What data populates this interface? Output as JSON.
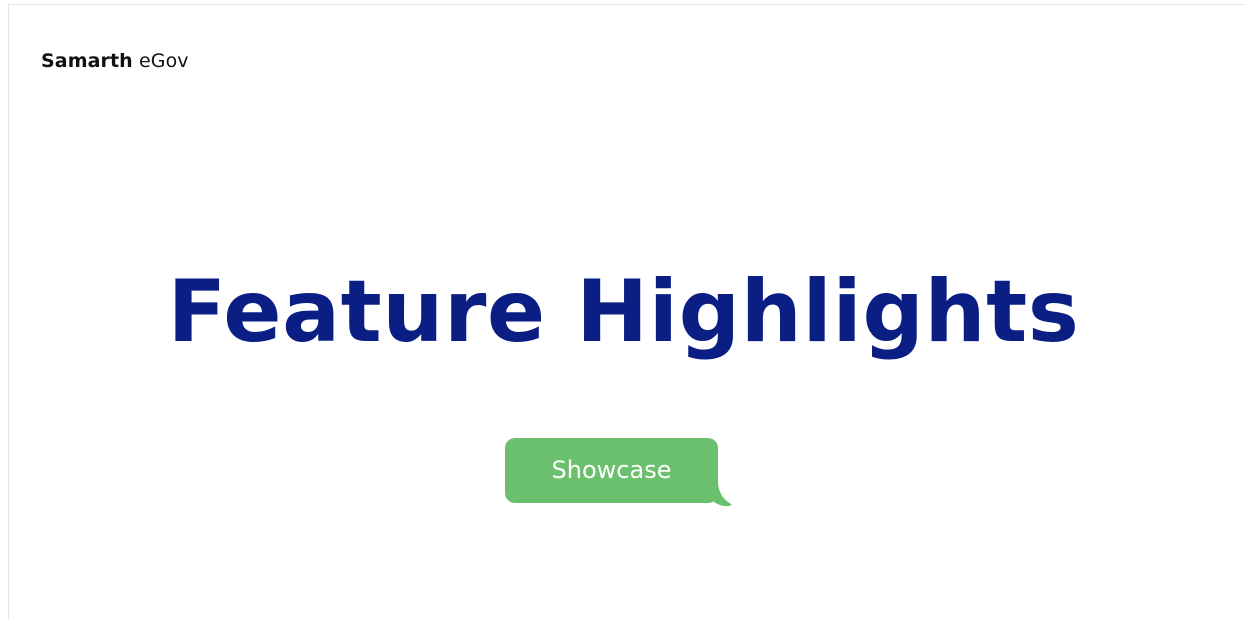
{
  "brand": {
    "strong": "Samarth",
    "rest": "eGov"
  },
  "title": "Feature Highlights",
  "button": {
    "label": "Showcase",
    "color": "#6bc06e"
  },
  "colors": {
    "title": "#0a1e84",
    "background": "#ffffff"
  }
}
